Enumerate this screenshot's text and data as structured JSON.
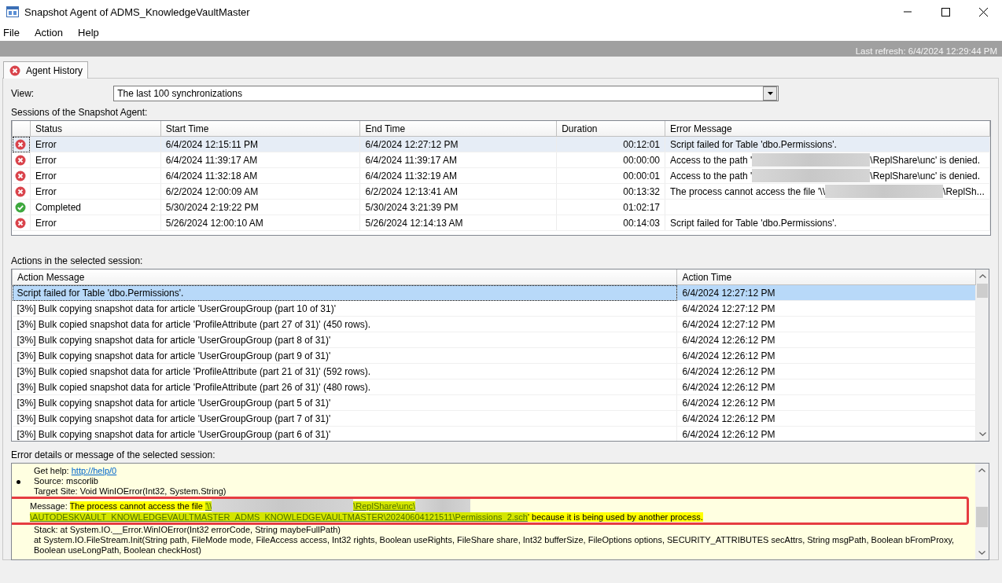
{
  "window": {
    "title": "Snapshot Agent of ADMS_KnowledgeVaultMaster"
  },
  "menu": [
    "File",
    "Action",
    "Help"
  ],
  "status": {
    "last_refresh": "Last refresh: 6/4/2024 12:29:44 PM"
  },
  "tabs": [
    {
      "label": "Agent History",
      "selected": true
    }
  ],
  "view": {
    "label": "View:",
    "value": "The last 100 synchronizations"
  },
  "sessions": {
    "label": "Sessions of the Snapshot Agent:",
    "columns": [
      "Status",
      "Start Time",
      "End Time",
      "Duration",
      "Error Message"
    ],
    "rows": [
      {
        "kind": "error",
        "selected": true,
        "status": "Error",
        "start": "6/4/2024 12:15:11 PM",
        "end": "6/4/2024 12:27:12 PM",
        "duration": "00:12:01",
        "error_message": [
          {
            "kind": "text",
            "text": "Script failed for Table 'dbo.Permissions'."
          }
        ]
      },
      {
        "kind": "error",
        "selected": false,
        "status": "Error",
        "start": "6/4/2024 11:39:17 AM",
        "end": "6/4/2024 11:39:17 AM",
        "duration": "00:00:00",
        "error_message": [
          {
            "kind": "text",
            "text": "Access to the path '"
          },
          {
            "kind": "redacted"
          },
          {
            "kind": "text",
            "text": "\\ReplShare\\unc' is denied."
          }
        ]
      },
      {
        "kind": "error",
        "selected": false,
        "status": "Error",
        "start": "6/4/2024 11:32:18 AM",
        "end": "6/4/2024 11:32:19 AM",
        "duration": "00:00:01",
        "error_message": [
          {
            "kind": "text",
            "text": "Access to the path '"
          },
          {
            "kind": "redacted"
          },
          {
            "kind": "text",
            "text": "\\ReplShare\\unc' is denied."
          }
        ]
      },
      {
        "kind": "error",
        "selected": false,
        "status": "Error",
        "start": "6/2/2024 12:00:09 AM",
        "end": "6/2/2024 12:13:41 AM",
        "duration": "00:13:32",
        "error_message": [
          {
            "kind": "text",
            "text": "The process cannot access the file '\\\\"
          },
          {
            "kind": "redacted"
          },
          {
            "kind": "text",
            "text": "\\ReplSh..."
          }
        ]
      },
      {
        "kind": "completed",
        "selected": false,
        "status": "Completed",
        "start": "5/30/2024 2:19:22 PM",
        "end": "5/30/2024 3:21:39 PM",
        "duration": "01:02:17"
      },
      {
        "kind": "error",
        "selected": false,
        "status": "Error",
        "start": "5/26/2024 12:00:10 AM",
        "end": "5/26/2024 12:14:13 AM",
        "duration": "00:14:03",
        "error_message": [
          {
            "kind": "text",
            "text": "Script failed for Table 'dbo.Permissions'."
          }
        ]
      }
    ]
  },
  "actions": {
    "label": "Actions in the selected session:",
    "columns": [
      "Action Message",
      "Action Time"
    ],
    "rows": [
      {
        "selected": true,
        "message": "Script failed for Table 'dbo.Permissions'.",
        "time": "6/4/2024 12:27:12 PM"
      },
      {
        "selected": false,
        "message": "[3%] Bulk copying snapshot data for article 'UserGroupGroup (part 10 of 31)'",
        "time": "6/4/2024 12:27:12 PM"
      },
      {
        "selected": false,
        "message": "[3%] Bulk copied snapshot data for article 'ProfileAttribute (part 27 of 31)' (450 rows).",
        "time": "6/4/2024 12:27:12 PM"
      },
      {
        "selected": false,
        "message": "[3%] Bulk copying snapshot data for article 'UserGroupGroup (part 8 of 31)'",
        "time": "6/4/2024 12:26:12 PM"
      },
      {
        "selected": false,
        "message": "[3%] Bulk copying snapshot data for article 'UserGroupGroup (part 9 of 31)'",
        "time": "6/4/2024 12:26:12 PM"
      },
      {
        "selected": false,
        "message": "[3%] Bulk copied snapshot data for article 'ProfileAttribute (part 21 of 31)' (592 rows).",
        "time": "6/4/2024 12:26:12 PM"
      },
      {
        "selected": false,
        "message": "[3%] Bulk copied snapshot data for article 'ProfileAttribute (part 26 of 31)' (480 rows).",
        "time": "6/4/2024 12:26:12 PM"
      },
      {
        "selected": false,
        "message": "[3%] Bulk copying snapshot data for article 'UserGroupGroup (part 5 of 31)'",
        "time": "6/4/2024 12:26:12 PM"
      },
      {
        "selected": false,
        "message": "[3%] Bulk copying snapshot data for article 'UserGroupGroup (part 7 of 31)'",
        "time": "6/4/2024 12:26:12 PM"
      },
      {
        "selected": false,
        "message": "[3%] Bulk copying snapshot data for article 'UserGroupGroup (part 6 of 31)'",
        "time": "6/4/2024 12:26:12 PM"
      }
    ]
  },
  "details": {
    "label": "Error details or message of the selected session:",
    "lines": [
      {
        "bullet": false,
        "annotated": false,
        "segments": [
          {
            "kind": "text",
            "text": "Get help: "
          },
          {
            "kind": "link",
            "text": "http://help/0"
          }
        ]
      },
      {
        "bullet": true,
        "annotated": false,
        "segments": [
          {
            "kind": "text",
            "text": "Source: mscorlib"
          }
        ]
      },
      {
        "bullet": false,
        "annotated": false,
        "segments": [
          {
            "kind": "text",
            "text": "Target Site: Void WinIOError(Int32, System.String)"
          }
        ]
      },
      {
        "bullet": false,
        "annotated": true,
        "segments": [
          {
            "kind": "text",
            "text": "Message: "
          },
          {
            "kind": "highlight",
            "text": "The process cannot access the file "
          },
          {
            "kind": "highlight_link",
            "text": "'\\\\"
          },
          {
            "kind": "redacted"
          },
          {
            "kind": "highlight_link",
            "text": "\\ReplShare\\unc\\"
          },
          {
            "kind": "redacted"
          },
          {
            "kind": "highlight_link",
            "text": "\\AUTODESKVAULT_KNOWLEDGEVAULTMASTER_ADMS_KNOWLEDGEVAULTMASTER\\20240604121511\\Permissions_"
          },
          {
            "kind": "highlight_link",
            "text": "2.sch"
          },
          {
            "kind": "highlight",
            "text": "' because it is being used by another process."
          }
        ]
      },
      {
        "bullet": false,
        "annotated": false,
        "segments": [
          {
            "kind": "text",
            "text": "Stack:    at System.IO.__Error.WinIOError(Int32 errorCode, String maybeFullPath)"
          }
        ]
      },
      {
        "bullet": false,
        "annotated": false,
        "segments": [
          {
            "kind": "text",
            "text": "at System.IO.FileStream.Init(String path, FileMode mode, FileAccess access, Int32 rights, Boolean useRights, FileShare share, Int32 bufferSize, FileOptions options, SECURITY_ATTRIBUTES secAttrs, String msgPath, Boolean bFromProxy, Boolean useLongPath, Boolean checkHost)"
          }
        ]
      }
    ]
  }
}
